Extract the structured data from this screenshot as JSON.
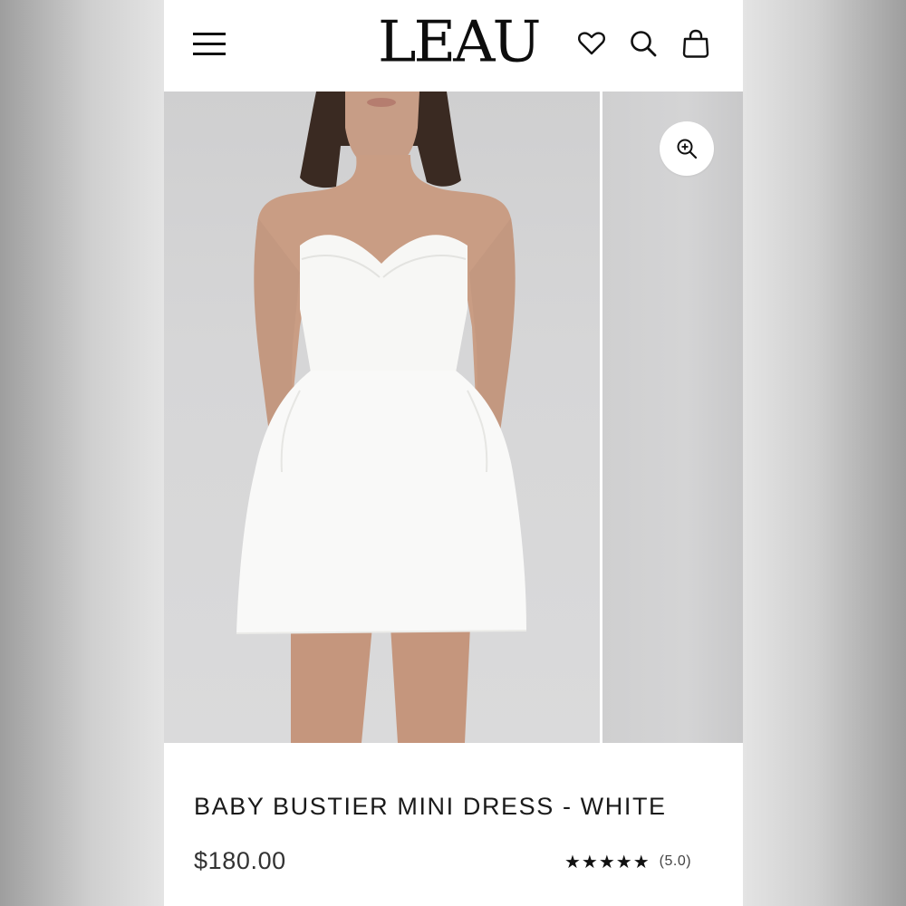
{
  "header": {
    "logo": "LEAU",
    "menu_icon": "hamburger-menu-icon",
    "wishlist_icon": "heart-icon",
    "search_icon": "search-icon",
    "cart_icon": "shopping-bag-icon"
  },
  "gallery": {
    "zoom_icon": "zoom-in-icon"
  },
  "product": {
    "title": "BABY BUSTIER MINI DRESS - WHITE",
    "price": "$180.00",
    "stars": "★★★★★",
    "rating": "(5.0)"
  },
  "colors": {
    "text": "#1a1a1a",
    "background": "#ffffff",
    "photo_bg": "#d4d4d5"
  }
}
